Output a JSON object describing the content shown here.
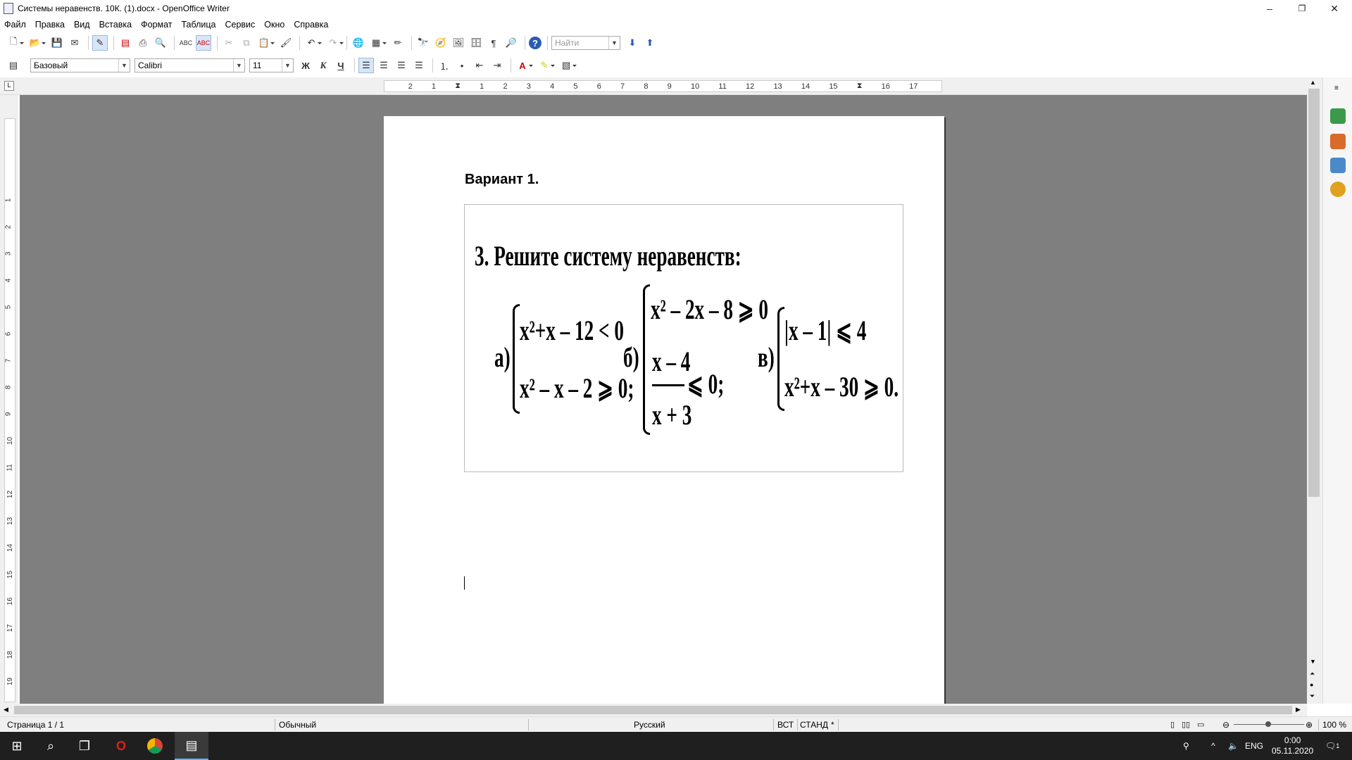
{
  "window": {
    "title": "Системы неравенств. 10К. (1).docx - OpenOffice Writer",
    "minimize": "–",
    "restore": "❐",
    "close": "✕"
  },
  "menu": [
    "Файл",
    "Правка",
    "Вид",
    "Вставка",
    "Формат",
    "Таблица",
    "Сервис",
    "Окно",
    "Справка"
  ],
  "toolbar": {
    "find_placeholder": "Найти"
  },
  "formatting": {
    "style": "Базовый",
    "font": "Calibri",
    "size": "11",
    "bold": "Ж",
    "italic": "К",
    "underline": "Ч"
  },
  "ruler": {
    "h_ticks": [
      "2",
      "1",
      "1",
      "2",
      "3",
      "4",
      "5",
      "6",
      "7",
      "8",
      "9",
      "10",
      "11",
      "12",
      "13",
      "14",
      "15",
      "16",
      "17"
    ],
    "v_ticks": [
      "1",
      "2",
      "3",
      "4",
      "5",
      "6",
      "7",
      "8",
      "9",
      "10",
      "11",
      "12",
      "13",
      "14",
      "15",
      "16",
      "17",
      "18",
      "19"
    ]
  },
  "document": {
    "heading": "Вариант 1.",
    "task": "3.  Решите систему неравенств:",
    "a_label": "а)",
    "a_line1": "x²+x – 12 < 0",
    "a_line2": "x² – x – 2 ⩾ 0;",
    "b_label": "б)",
    "b_line1": "x² – 2x – 8 ⩾ 0",
    "b_num": "x – 4",
    "b_rel": "⩽ 0;",
    "b_den": "x + 3",
    "c_label": "в)",
    "c_line1": "|x – 1| ⩽ 4",
    "c_line2": "x²+x – 30 ⩾ 0."
  },
  "status": {
    "page": "Страница 1 / 1",
    "style": "Обычный",
    "lang": "Русский",
    "ins": "ВСТ",
    "sel": "СТАНД",
    "mod": "*",
    "zoom": "100 %"
  },
  "taskbar": {
    "lang": "ENG",
    "time": "0:00",
    "date": "05.11.2020",
    "notif": "1"
  }
}
